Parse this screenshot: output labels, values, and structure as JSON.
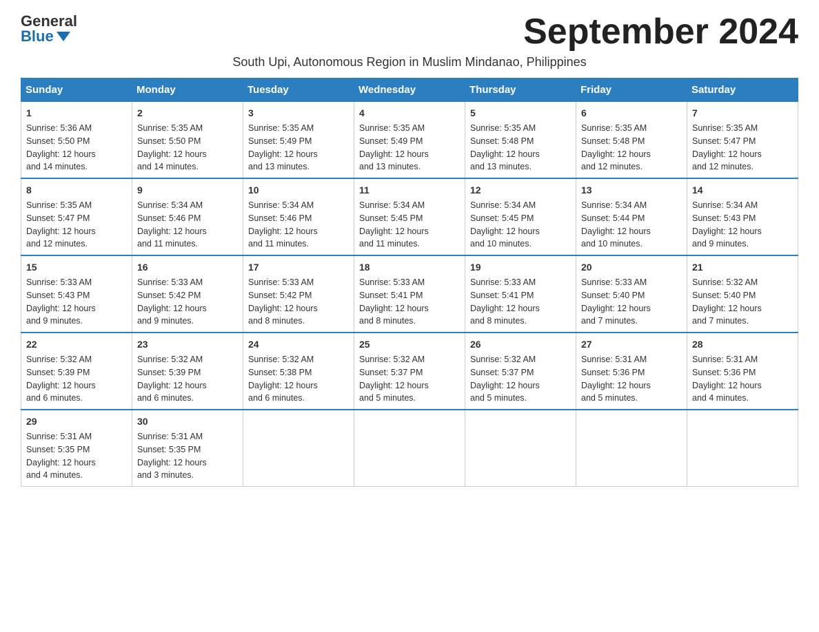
{
  "header": {
    "logo_general": "General",
    "logo_blue": "Blue",
    "month_title": "September 2024",
    "subtitle": "South Upi, Autonomous Region in Muslim Mindanao, Philippines"
  },
  "days_of_week": [
    "Sunday",
    "Monday",
    "Tuesday",
    "Wednesday",
    "Thursday",
    "Friday",
    "Saturday"
  ],
  "weeks": [
    [
      {
        "day": "1",
        "sunrise": "5:36 AM",
        "sunset": "5:50 PM",
        "daylight": "12 hours and 14 minutes."
      },
      {
        "day": "2",
        "sunrise": "5:35 AM",
        "sunset": "5:50 PM",
        "daylight": "12 hours and 14 minutes."
      },
      {
        "day": "3",
        "sunrise": "5:35 AM",
        "sunset": "5:49 PM",
        "daylight": "12 hours and 13 minutes."
      },
      {
        "day": "4",
        "sunrise": "5:35 AM",
        "sunset": "5:49 PM",
        "daylight": "12 hours and 13 minutes."
      },
      {
        "day": "5",
        "sunrise": "5:35 AM",
        "sunset": "5:48 PM",
        "daylight": "12 hours and 13 minutes."
      },
      {
        "day": "6",
        "sunrise": "5:35 AM",
        "sunset": "5:48 PM",
        "daylight": "12 hours and 12 minutes."
      },
      {
        "day": "7",
        "sunrise": "5:35 AM",
        "sunset": "5:47 PM",
        "daylight": "12 hours and 12 minutes."
      }
    ],
    [
      {
        "day": "8",
        "sunrise": "5:35 AM",
        "sunset": "5:47 PM",
        "daylight": "12 hours and 12 minutes."
      },
      {
        "day": "9",
        "sunrise": "5:34 AM",
        "sunset": "5:46 PM",
        "daylight": "12 hours and 11 minutes."
      },
      {
        "day": "10",
        "sunrise": "5:34 AM",
        "sunset": "5:46 PM",
        "daylight": "12 hours and 11 minutes."
      },
      {
        "day": "11",
        "sunrise": "5:34 AM",
        "sunset": "5:45 PM",
        "daylight": "12 hours and 11 minutes."
      },
      {
        "day": "12",
        "sunrise": "5:34 AM",
        "sunset": "5:45 PM",
        "daylight": "12 hours and 10 minutes."
      },
      {
        "day": "13",
        "sunrise": "5:34 AM",
        "sunset": "5:44 PM",
        "daylight": "12 hours and 10 minutes."
      },
      {
        "day": "14",
        "sunrise": "5:34 AM",
        "sunset": "5:43 PM",
        "daylight": "12 hours and 9 minutes."
      }
    ],
    [
      {
        "day": "15",
        "sunrise": "5:33 AM",
        "sunset": "5:43 PM",
        "daylight": "12 hours and 9 minutes."
      },
      {
        "day": "16",
        "sunrise": "5:33 AM",
        "sunset": "5:42 PM",
        "daylight": "12 hours and 9 minutes."
      },
      {
        "day": "17",
        "sunrise": "5:33 AM",
        "sunset": "5:42 PM",
        "daylight": "12 hours and 8 minutes."
      },
      {
        "day": "18",
        "sunrise": "5:33 AM",
        "sunset": "5:41 PM",
        "daylight": "12 hours and 8 minutes."
      },
      {
        "day": "19",
        "sunrise": "5:33 AM",
        "sunset": "5:41 PM",
        "daylight": "12 hours and 8 minutes."
      },
      {
        "day": "20",
        "sunrise": "5:33 AM",
        "sunset": "5:40 PM",
        "daylight": "12 hours and 7 minutes."
      },
      {
        "day": "21",
        "sunrise": "5:32 AM",
        "sunset": "5:40 PM",
        "daylight": "12 hours and 7 minutes."
      }
    ],
    [
      {
        "day": "22",
        "sunrise": "5:32 AM",
        "sunset": "5:39 PM",
        "daylight": "12 hours and 6 minutes."
      },
      {
        "day": "23",
        "sunrise": "5:32 AM",
        "sunset": "5:39 PM",
        "daylight": "12 hours and 6 minutes."
      },
      {
        "day": "24",
        "sunrise": "5:32 AM",
        "sunset": "5:38 PM",
        "daylight": "12 hours and 6 minutes."
      },
      {
        "day": "25",
        "sunrise": "5:32 AM",
        "sunset": "5:37 PM",
        "daylight": "12 hours and 5 minutes."
      },
      {
        "day": "26",
        "sunrise": "5:32 AM",
        "sunset": "5:37 PM",
        "daylight": "12 hours and 5 minutes."
      },
      {
        "day": "27",
        "sunrise": "5:31 AM",
        "sunset": "5:36 PM",
        "daylight": "12 hours and 5 minutes."
      },
      {
        "day": "28",
        "sunrise": "5:31 AM",
        "sunset": "5:36 PM",
        "daylight": "12 hours and 4 minutes."
      }
    ],
    [
      {
        "day": "29",
        "sunrise": "5:31 AM",
        "sunset": "5:35 PM",
        "daylight": "12 hours and 4 minutes."
      },
      {
        "day": "30",
        "sunrise": "5:31 AM",
        "sunset": "5:35 PM",
        "daylight": "12 hours and 3 minutes."
      },
      null,
      null,
      null,
      null,
      null
    ]
  ],
  "labels": {
    "sunrise": "Sunrise:",
    "sunset": "Sunset:",
    "daylight": "Daylight:"
  }
}
